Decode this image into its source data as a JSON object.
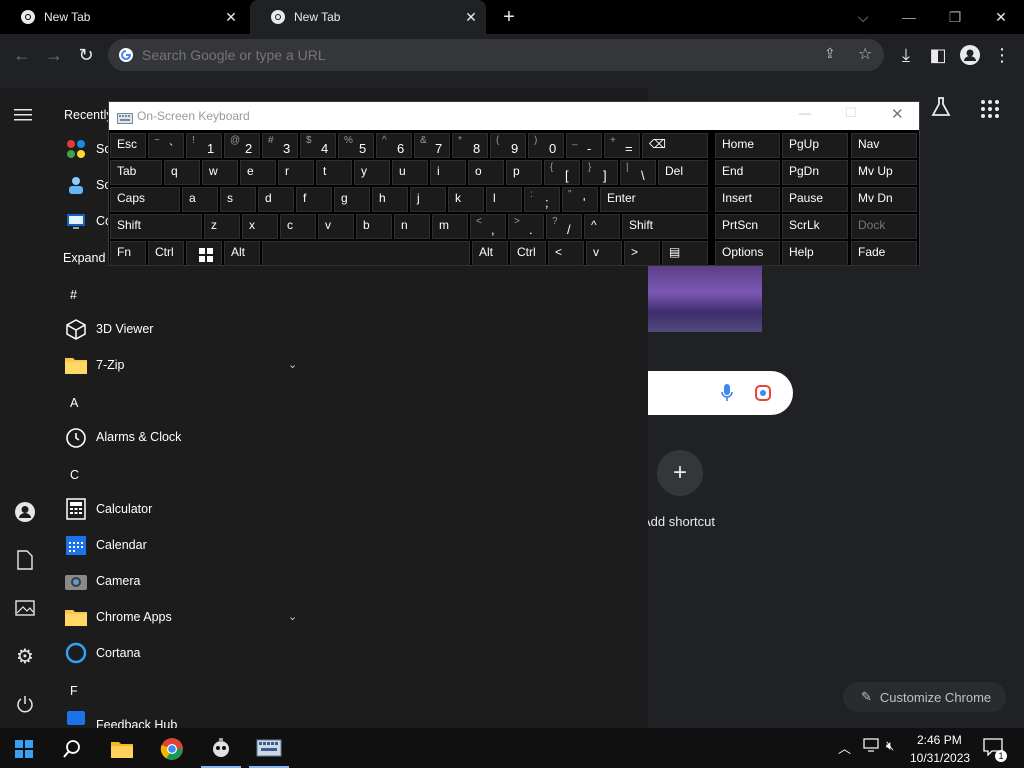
{
  "browser": {
    "tabs": [
      {
        "label": "New Tab"
      },
      {
        "label": "New Tab"
      }
    ],
    "omnibox_placeholder": "Search Google or type a URL",
    "customize_label": "Customize Chrome",
    "add_shortcut_label": "Add shortcut"
  },
  "start_menu": {
    "recent_header": "Recently added",
    "recent_items": [
      {
        "label": "Sc"
      },
      {
        "label": "Sc"
      },
      {
        "label": "Co"
      }
    ],
    "expand_label": "Expand",
    "letters": [
      "#",
      "A",
      "C",
      "F"
    ],
    "apps": [
      {
        "label": "3D Viewer"
      },
      {
        "label": "7-Zip"
      },
      {
        "label": "Alarms & Clock"
      },
      {
        "label": "Calculator"
      },
      {
        "label": "Calendar"
      },
      {
        "label": "Camera"
      },
      {
        "label": "Chrome Apps"
      },
      {
        "label": "Cortana"
      },
      {
        "label": "Feedback Hub"
      }
    ]
  },
  "osk": {
    "title": "On-Screen Keyboard",
    "row1": [
      {
        "main": "Esc",
        "sub": ""
      },
      {
        "main": "`",
        "sub": "~"
      },
      {
        "main": "1",
        "sub": "!"
      },
      {
        "main": "2",
        "sub": "@"
      },
      {
        "main": "3",
        "sub": "#"
      },
      {
        "main": "4",
        "sub": "$"
      },
      {
        "main": "5",
        "sub": "%"
      },
      {
        "main": "6",
        "sub": "^"
      },
      {
        "main": "7",
        "sub": "&"
      },
      {
        "main": "8",
        "sub": "*"
      },
      {
        "main": "9",
        "sub": "("
      },
      {
        "main": "0",
        "sub": ")"
      },
      {
        "main": "-",
        "sub": "_"
      },
      {
        "main": "=",
        "sub": "+"
      },
      {
        "main": "⌫",
        "sub": ""
      }
    ],
    "row2": [
      "Tab",
      "q",
      "w",
      "e",
      "r",
      "t",
      "y",
      "u",
      "i",
      "o",
      "p",
      "[",
      "]",
      "\\",
      "Del"
    ],
    "row2_sub": [
      "",
      "",
      "",
      "",
      "",
      "",
      "",
      "",
      "",
      "",
      "",
      "{",
      "}",
      "|",
      ""
    ],
    "row3": [
      "Caps",
      "a",
      "s",
      "d",
      "f",
      "g",
      "h",
      "j",
      "k",
      "l",
      ";",
      "'",
      "Enter"
    ],
    "row3_sub": [
      "",
      "",
      "",
      "",
      "",
      "",
      "",
      "",
      "",
      "",
      ":",
      "\"",
      ""
    ],
    "row4": [
      "Shift",
      "z",
      "x",
      "c",
      "v",
      "b",
      "n",
      "m",
      ",",
      ".",
      "/",
      "^",
      "Shift"
    ],
    "row4_sub": [
      "",
      "",
      "",
      "",
      "",
      "",
      "",
      "",
      "<",
      ">",
      "?",
      "",
      ""
    ],
    "row5": [
      "Fn",
      "Ctrl",
      "",
      "Alt",
      "",
      "Alt",
      "Ctrl",
      "<",
      "v",
      ">",
      "▤"
    ],
    "nav_keys": [
      [
        "Home",
        "PgUp",
        "Nav"
      ],
      [
        "End",
        "PgDn",
        "Mv Up"
      ],
      [
        "Insert",
        "Pause",
        "Mv Dn"
      ],
      [
        "PrtScn",
        "ScrLk",
        "Dock"
      ],
      [
        "Options",
        "Help",
        "Fade"
      ]
    ]
  },
  "taskbar": {
    "time": "2:46 PM",
    "date": "10/31/2023",
    "notification_count": "1"
  },
  "colors": {
    "accent_blue": "#4c8bf5",
    "chrome_dark": "#202124",
    "start_bg": "#1c1c1c"
  }
}
